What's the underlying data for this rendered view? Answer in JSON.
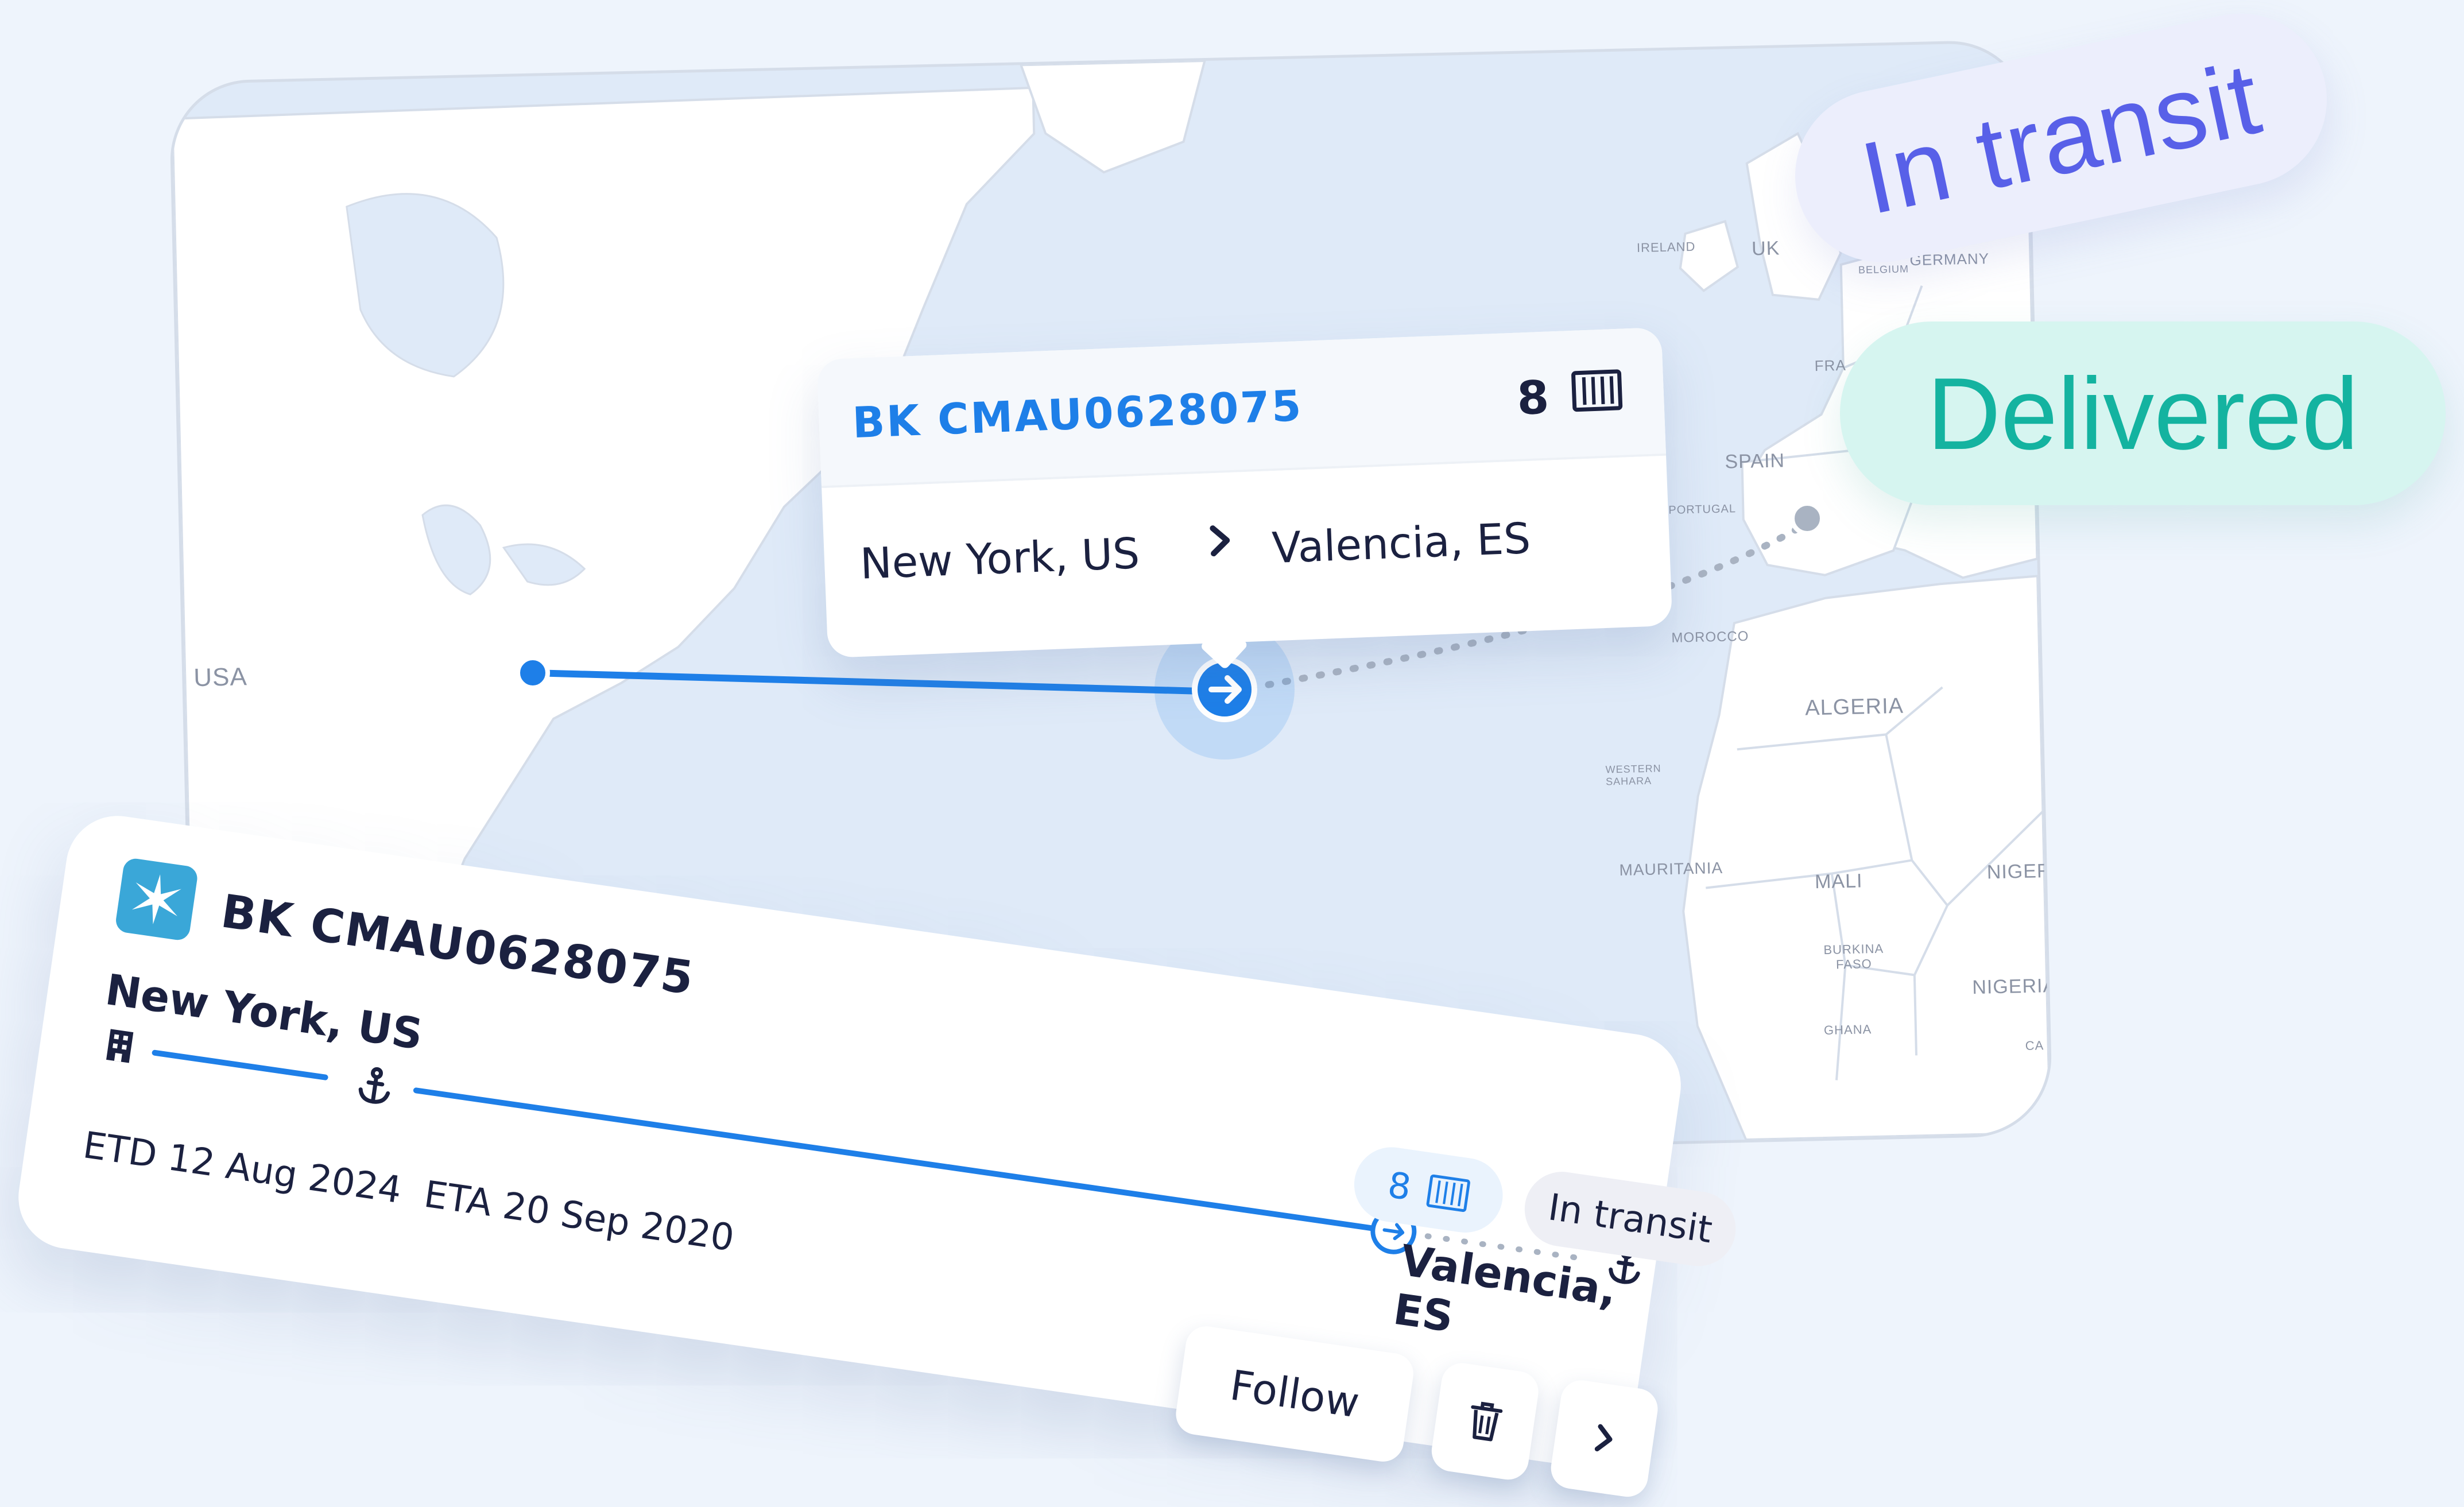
{
  "map": {
    "labels": {
      "usa": "USA",
      "ireland": "IRELAND",
      "uk": "UK",
      "belgium": "BELGIUM",
      "germany": "GERMANY",
      "france": "FRA",
      "spain": "SPAIN",
      "portugal": "PORTUGAL",
      "morocco": "MOROCCO",
      "algeria": "ALGERIA",
      "western_sahara": "WESTERN SAHARA",
      "mauritania": "MAURITANIA",
      "mali": "MALI",
      "niger": "NIGER",
      "burkina_faso": "BURKINA FASO",
      "nigeria": "NIGERIA",
      "ghana": "GHANA",
      "cameroon": "CA"
    },
    "colors": {
      "sea": "#dfeaf8",
      "land": "#ffffff",
      "route": "#1e7fe8",
      "pending_route": "#a9b3c2"
    }
  },
  "tooltip": {
    "booking_code": "BK CMAU0628075",
    "container_count": "8",
    "container_icon": "container-icon",
    "origin": "New York, US",
    "destination": "Valencia, ES",
    "separator_icon": "chevron-right-icon"
  },
  "pills": {
    "in_transit": "In transit",
    "delivered": "Delivered"
  },
  "card": {
    "carrier_logo": "star-logo-icon",
    "booking_code": "BK CMAU0628075",
    "origin": "New York, US",
    "destination": "Valencia, ES",
    "etd": "ETD 12 Aug 2024",
    "eta": "ETA 20 Sep 2020",
    "container_count": "8",
    "status": "In transit",
    "actions": {
      "follow": "Follow",
      "delete_icon": "trash-icon",
      "next_icon": "chevron-right-icon"
    }
  }
}
